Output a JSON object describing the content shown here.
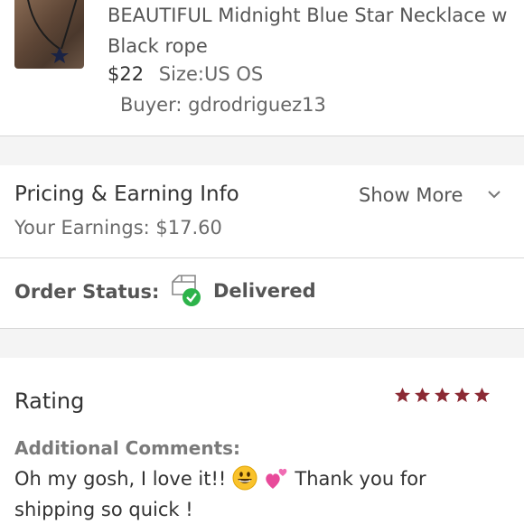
{
  "product": {
    "title": "BEAUTIFUL Midnight Blue Star Necklace w Black rope",
    "price": "$22",
    "size": "Size:US OS",
    "buyer": "Buyer: gdrodriguez13",
    "thumbnail_icon": "necklace-photo"
  },
  "pricing": {
    "title": "Pricing & Earning Info",
    "show_more": "Show More",
    "earnings": "Your Earnings: $17.60"
  },
  "order_status": {
    "label": "Order Status:",
    "value": "Delivered",
    "icon": "delivered-box-icon",
    "icon_color": "#2db34a"
  },
  "rating": {
    "title": "Rating",
    "stars": 5,
    "star_color": "#8b2a34",
    "comments_label": "Additional Comments:",
    "comment_before": "Oh my gosh, I love it!!",
    "comment_after": "Thank you for shipping so quick !",
    "emojis": [
      "grinning-face-emoji",
      "two-hearts-emoji"
    ]
  },
  "colors": {
    "divider": "#d6d6d6",
    "section_gap": "#f4f4f4"
  }
}
